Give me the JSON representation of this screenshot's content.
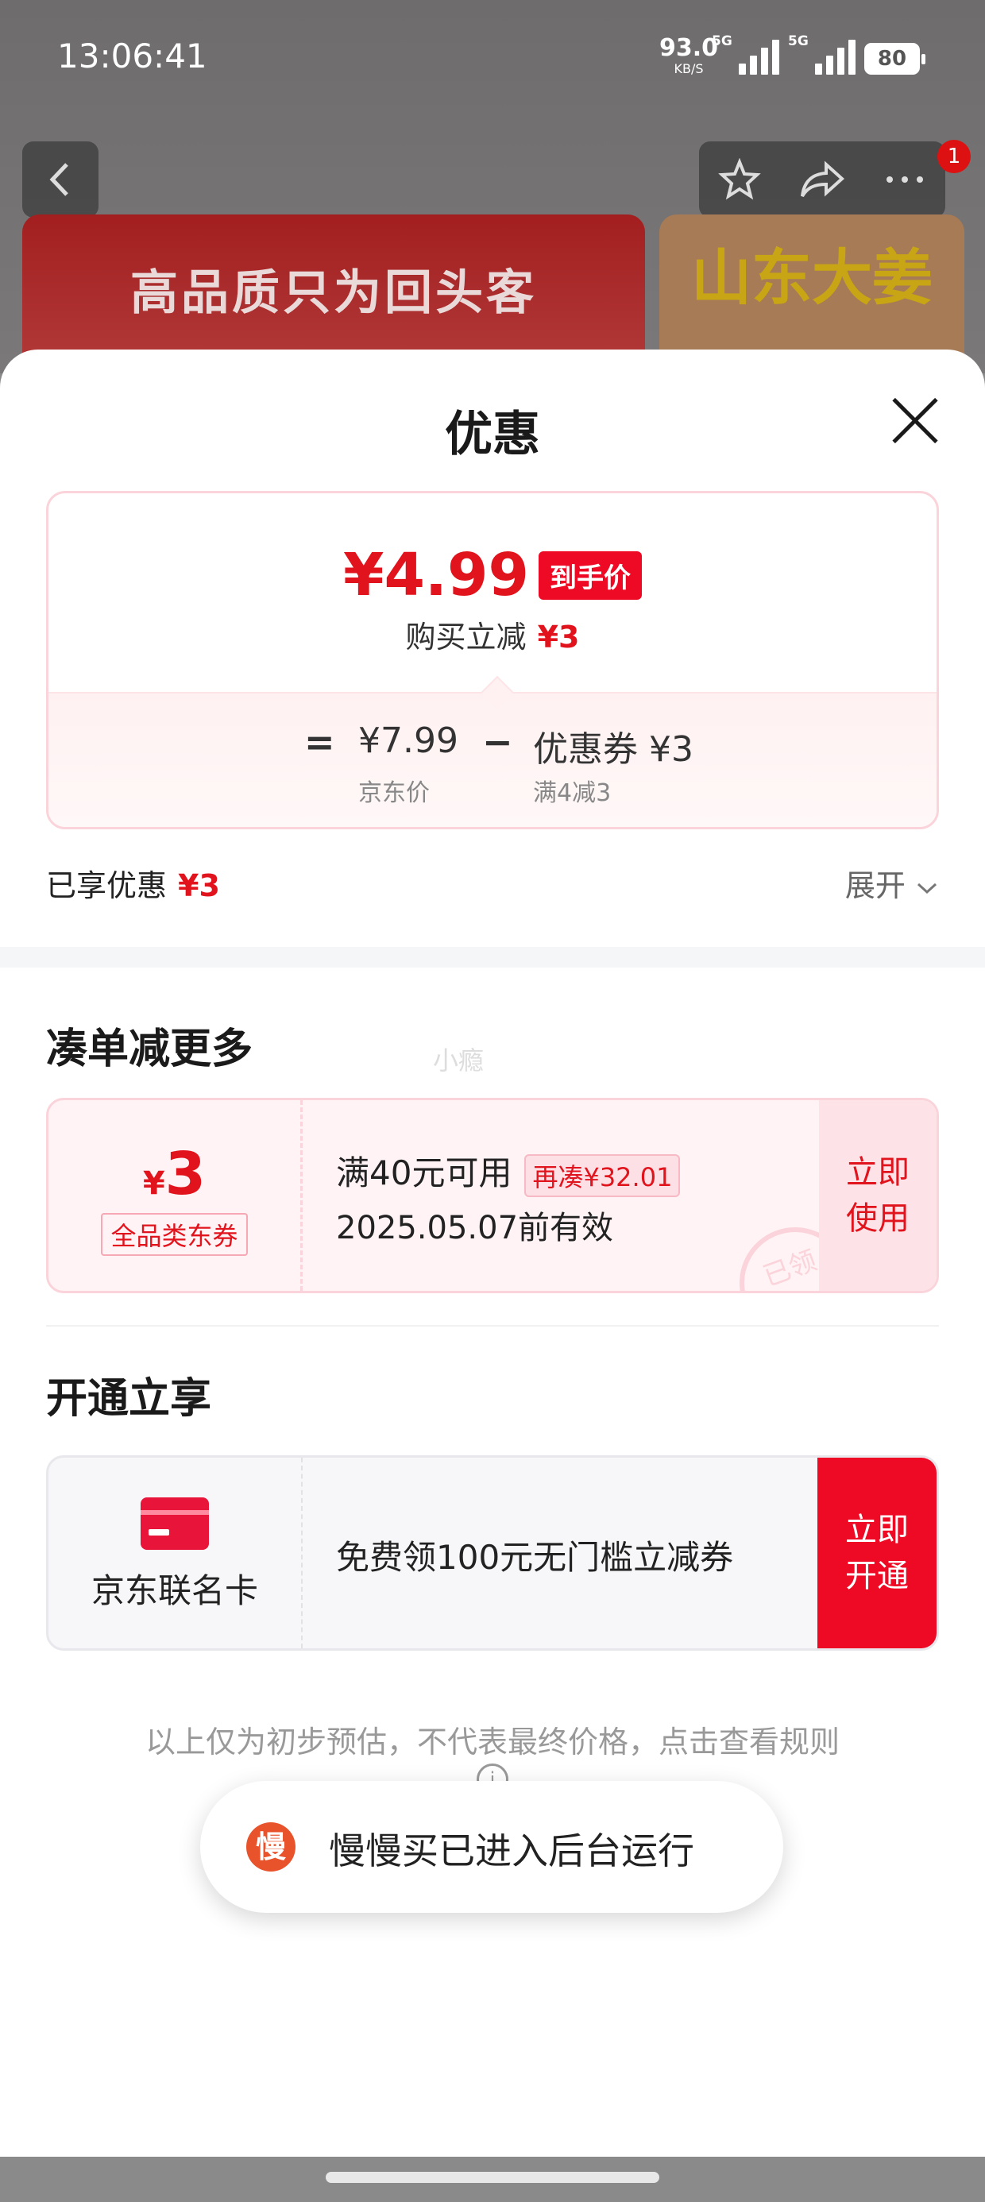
{
  "status_bar": {
    "time": "13:06:41",
    "net_speed": "93.0",
    "net_unit": "KB/S",
    "sim1": "5G",
    "sim2": "5G",
    "battery": "80"
  },
  "background": {
    "banner_left_text": "高品质只为回头客",
    "banner_right_text": "山东大姜",
    "badge_count": "1",
    "icons": {
      "back": "chevron-left-icon",
      "fav": "star-icon",
      "share": "share-icon",
      "more": "more-icon"
    }
  },
  "sheet": {
    "title": "优惠",
    "price": {
      "final_price": "¥4.99",
      "final_tag": "到手价",
      "reduce_label": "购买立减",
      "reduce_value": "¥3",
      "equals": "=",
      "jd_price": "¥7.99",
      "jd_label": "京东价",
      "minus": "−",
      "coupon_value": "优惠券 ¥3",
      "coupon_rule": "满4减3"
    },
    "enjoyed_label": "已享优惠",
    "enjoyed_value": "¥3",
    "expand_label": "展开",
    "combine": {
      "title": "凑单减更多",
      "watermark": "小瘾",
      "coupon": {
        "currency": "¥",
        "amount": "3",
        "type": "全品类东券",
        "condition": "满40元可用",
        "chip": "再凑¥32.01",
        "expiry": "2025.05.07前有效",
        "stamp": "已领",
        "action": "立即使用"
      }
    },
    "open": {
      "title": "开通立享",
      "card_name": "京东联名卡",
      "card_desc": "免费领100元无门槛立减券",
      "action": "立即开通"
    },
    "disclaimer": "以上仅为初步预估，不代表最终价格，点击查看规则"
  },
  "toast": {
    "icon_char": "慢",
    "text": "慢慢买已进入后台运行"
  },
  "colors": {
    "accent": "#e1141d",
    "accent_bg": "#fff3f5"
  }
}
